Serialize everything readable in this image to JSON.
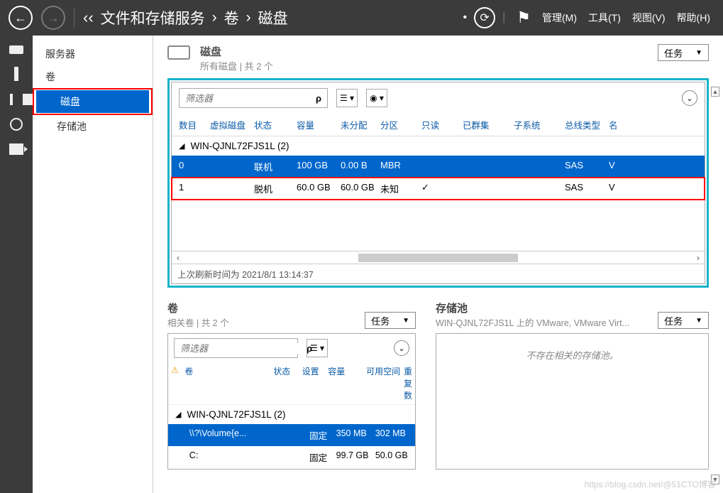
{
  "topbar": {
    "breadcrumb": [
      "文件和存储服务",
      "卷",
      "磁盘"
    ],
    "menu": {
      "manage": "管理(M)",
      "tools": "工具(T)",
      "view": "视图(V)",
      "help": "帮助(H)"
    }
  },
  "sidenav": {
    "items": [
      "服务器",
      "卷"
    ],
    "sub": [
      "磁盘",
      "存储池"
    ],
    "selected": "磁盘"
  },
  "disks": {
    "title": "磁盘",
    "subtitle": "所有磁盘 | 共 2 个",
    "tasks_label": "任务",
    "filter_placeholder": "筛选器",
    "columns": {
      "num": "数目",
      "vdisk": "虚拟磁盘",
      "state": "状态",
      "cap": "容量",
      "unalloc": "未分配",
      "part": "分区",
      "ro": "只读",
      "clust": "已群集",
      "sub": "子系统",
      "bus": "总线类型",
      "name": "名"
    },
    "group": "WIN-QJNL72FJS1L (2)",
    "rows": [
      {
        "num": "0",
        "state": "联机",
        "cap": "100 GB",
        "unalloc": "0.00 B",
        "part": "MBR",
        "ro": "",
        "bus": "SAS",
        "name": "V"
      },
      {
        "num": "1",
        "state": "脱机",
        "cap": "60.0 GB",
        "unalloc": "60.0 GB",
        "part": "未知",
        "ro": "✓",
        "bus": "SAS",
        "name": "V"
      }
    ],
    "status": "上次刷新时间为 2021/8/1 13:14:37"
  },
  "volumes": {
    "title": "卷",
    "subtitle": "相关卷 | 共 2 个",
    "tasks_label": "任务",
    "filter_placeholder": "筛选器",
    "columns": {
      "warn": "⚠",
      "vol": "卷",
      "state": "状态",
      "set": "设置",
      "cap": "容量",
      "free": "可用空间",
      "rep": "重复数"
    },
    "group": "WIN-QJNL72FJS1L (2)",
    "rows": [
      {
        "vol": "\\\\?\\Volume{e...",
        "set": "固定",
        "cap": "350 MB",
        "free": "302 MB"
      },
      {
        "vol": "C:",
        "set": "固定",
        "cap": "99.7 GB",
        "free": "50.0 GB"
      }
    ]
  },
  "pools": {
    "title": "存储池",
    "subtitle": "WIN-QJNL72FJS1L 上的 VMware, VMware Virt...",
    "tasks_label": "任务",
    "empty": "不存在相关的存储池。"
  },
  "watermark": "https://blog.csdn.net/@51CTO博客",
  "chart_data": {
    "type": "table",
    "title": "磁盘",
    "columns": [
      "数目",
      "虚拟磁盘",
      "状态",
      "容量",
      "未分配",
      "分区",
      "只读",
      "已群集",
      "子系统",
      "总线类型"
    ],
    "rows": [
      [
        "0",
        "",
        "联机",
        "100 GB",
        "0.00 B",
        "MBR",
        "",
        "",
        "",
        "SAS"
      ],
      [
        "1",
        "",
        "脱机",
        "60.0 GB",
        "60.0 GB",
        "未知",
        "✓",
        "",
        "",
        "SAS"
      ]
    ]
  }
}
